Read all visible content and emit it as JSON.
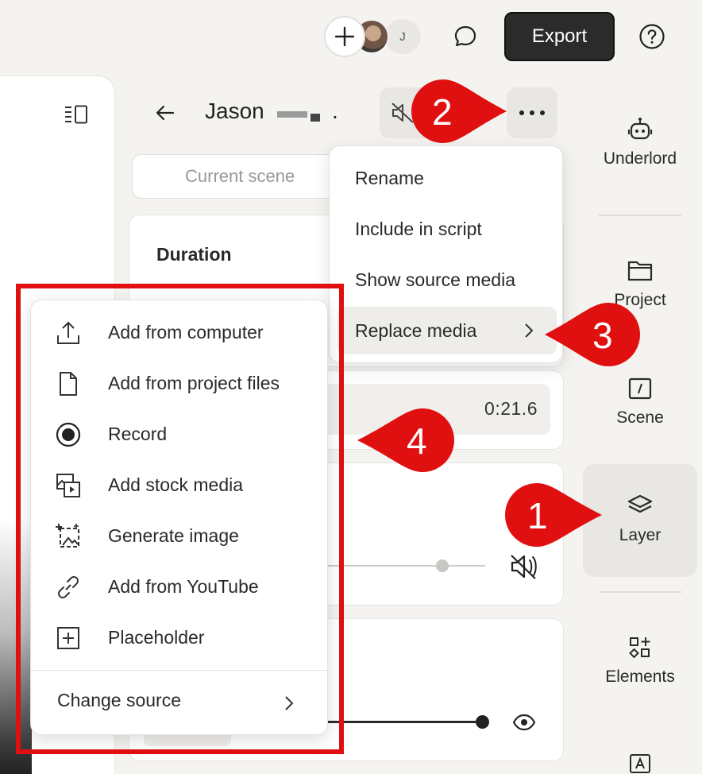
{
  "topbar": {
    "collaborator_initial": "J",
    "export_label": "Export"
  },
  "layer": {
    "title": "Jason",
    "title_suffix": ".",
    "scene_tab": "Current scene",
    "duration_label": "Duration",
    "time_value": "0:21.6",
    "volume_level": 0.6,
    "opacity_level": 0.95
  },
  "context_menu": {
    "items": [
      {
        "label": "Rename"
      },
      {
        "label": "Include in script"
      },
      {
        "label": "Show source media"
      },
      {
        "label": "Replace media"
      }
    ]
  },
  "submenu": {
    "items": [
      {
        "label": "Add from computer",
        "icon": "upload-icon"
      },
      {
        "label": "Add from project files",
        "icon": "file-icon"
      },
      {
        "label": "Record",
        "icon": "record-icon"
      },
      {
        "label": "Add stock media",
        "icon": "stock-media-icon"
      },
      {
        "label": "Generate image",
        "icon": "generate-image-icon"
      },
      {
        "label": "Add from YouTube",
        "icon": "link-icon"
      },
      {
        "label": "Placeholder",
        "icon": "placeholder-icon"
      }
    ],
    "change_source": "Change source"
  },
  "rail": {
    "items": [
      {
        "label": "Underlord",
        "icon": "robot-icon"
      },
      {
        "label": "Project",
        "icon": "folder-icon"
      },
      {
        "label": "Scene",
        "icon": "scene-icon"
      },
      {
        "label": "Layer",
        "icon": "layers-icon"
      },
      {
        "label": "Elements",
        "icon": "elements-icon"
      }
    ]
  },
  "callouts": [
    "1",
    "2",
    "3",
    "4"
  ],
  "colors": {
    "callout_red": "#e01010",
    "export_bg": "#2b2b2b",
    "background": "#f5f3f0"
  }
}
